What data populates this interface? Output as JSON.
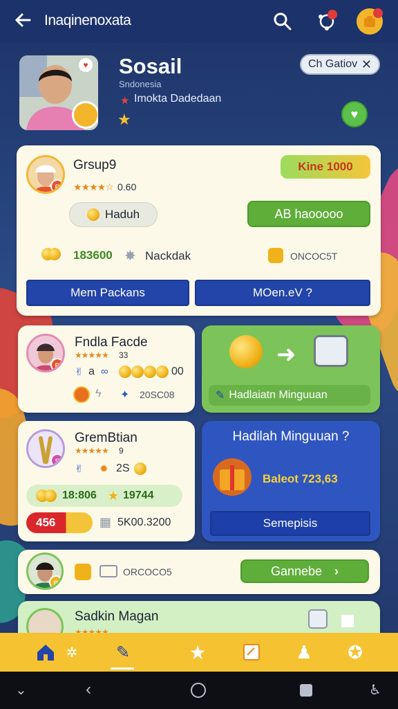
{
  "header": {
    "title": "Inaqinenoxata"
  },
  "profile": {
    "name": "Sosail",
    "country": "Sndonesia",
    "status": "Imokta Dadedaan",
    "chip_label": "Ch Gatiov"
  },
  "cards": {
    "group": {
      "name": "Grsup9",
      "rating": "0.60",
      "price_badge": "Kine 1000",
      "pill_label": "Haduh",
      "green_button": "AB haooooo",
      "coins_value": "183600",
      "tag_label": "Nackdak",
      "code": "ONCOC5T",
      "btn_left": "Mem Packans",
      "btn_right": "MOen.eV ?"
    },
    "fndla": {
      "name": "Fndla Facde",
      "rating": "33",
      "line1_a": "a",
      "line1_b": "00",
      "code": "20SC08"
    },
    "promo_green": {
      "label": "Hadlaiatn Minguuan"
    },
    "grembtian": {
      "name": "GremBtian",
      "rating": "9",
      "line1": "2S",
      "stat_left": "18:806",
      "stat_right": "19744",
      "red_badge": "456",
      "value": "5K00.3200"
    },
    "promo_blue": {
      "title": "Hadilah Minguuan ?",
      "reward": "Baleot 723,63",
      "button": "Semepisis"
    },
    "row4": {
      "code": "ORCOCO5",
      "button": "Gannebe"
    },
    "row5": {
      "name": "Sadkin Magan"
    }
  },
  "colors": {
    "brand_blue": "#2344a8",
    "accent_green": "#5fae3a",
    "nav_yellow": "#f5c232"
  }
}
